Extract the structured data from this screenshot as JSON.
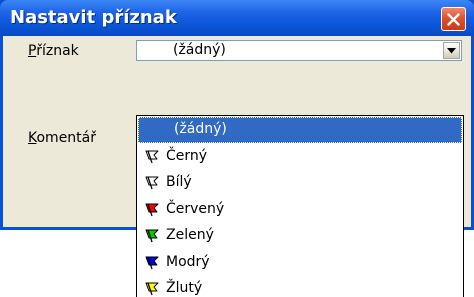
{
  "window": {
    "title": "Nastavit příznak"
  },
  "form": {
    "flag_label": "Příznak",
    "flag_label_accesskey": "P",
    "flag_label_rest": "říznak",
    "comment_label": "Komentář",
    "comment_label_accesskey": "K",
    "comment_label_rest": "omentář",
    "flag_value": "(žádný)"
  },
  "dropdown": {
    "options": [
      {
        "label": "(žádný)",
        "flag_color": "",
        "selected": true
      },
      {
        "label": "Černý",
        "flag_color": "#ffffff",
        "icon": "flag-outline-icon"
      },
      {
        "label": "Bílý",
        "flag_color": "#ffffff",
        "icon": "flag-outline-icon"
      },
      {
        "label": "Červený",
        "flag_color": "#ff0000",
        "icon": "red-flag-icon"
      },
      {
        "label": "Zelený",
        "flag_color": "#00d000",
        "icon": "green-flag-icon"
      },
      {
        "label": "Modrý",
        "flag_color": "#0000ff",
        "icon": "blue-flag-icon"
      },
      {
        "label": "Žlutý",
        "flag_color": "#ffff00",
        "icon": "yellow-flag-icon"
      }
    ]
  },
  "colors": {
    "titlebar": "#0a55d8",
    "selection": "#316ac5",
    "dialog_bg": "#ece9d8"
  }
}
